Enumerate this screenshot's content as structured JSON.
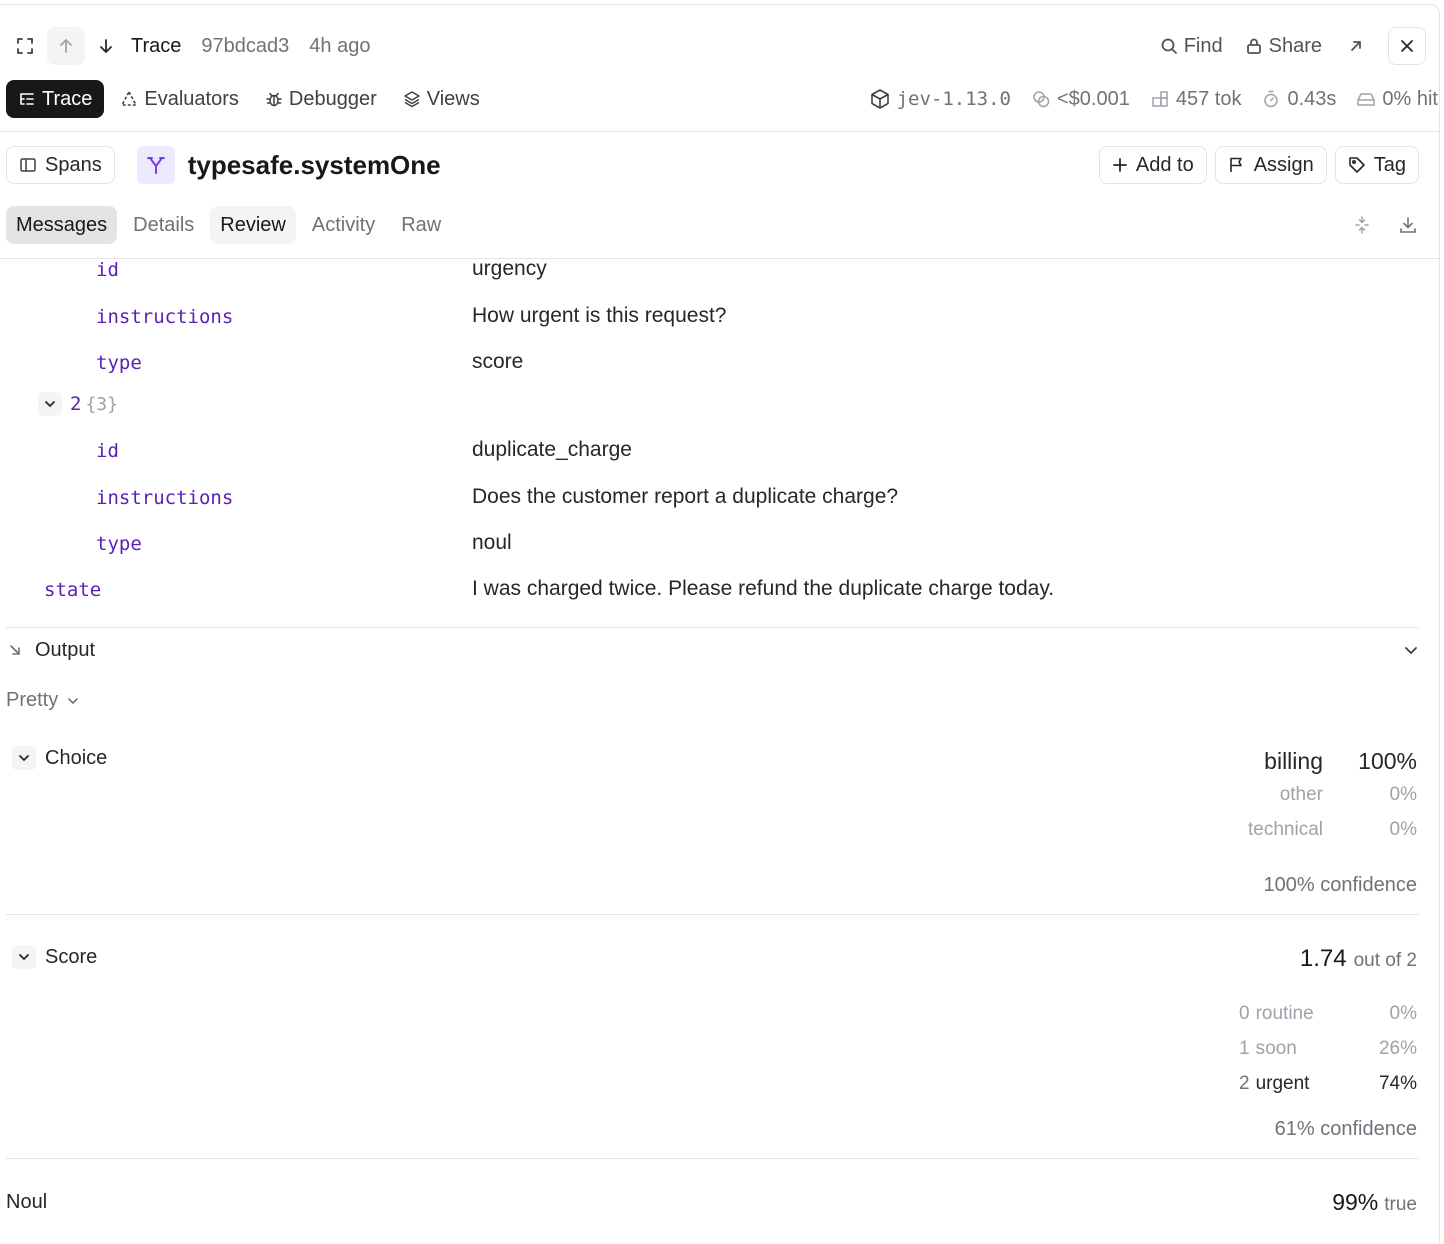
{
  "header": {
    "trace_label": "Trace",
    "trace_id": "97bdcad3",
    "time_ago": "4h ago",
    "find_label": "Find",
    "share_label": "Share"
  },
  "nav": {
    "tabs": [
      {
        "label": "Trace",
        "icon": "trace-list-icon"
      },
      {
        "label": "Evaluators",
        "icon": "triangle-dashed-icon"
      },
      {
        "label": "Debugger",
        "icon": "bug-icon"
      },
      {
        "label": "Views",
        "icon": "layers-icon"
      }
    ],
    "metrics": {
      "version": "jev-1.13.0",
      "cost": "<$0.001",
      "tokens": "457 tok",
      "latency": "0.43s",
      "cache": "0% hit"
    }
  },
  "span": {
    "spans_label": "Spans",
    "title": "typesafe.systemOne",
    "add_to_label": "Add to",
    "assign_label": "Assign",
    "tag_label": "Tag"
  },
  "subtabs": [
    "Messages",
    "Details",
    "Review",
    "Activity",
    "Raw"
  ],
  "input": {
    "item1": {
      "id_key": "id",
      "id_val": "urgency",
      "instr_key": "instructions",
      "instr_val": "How urgent is this request?",
      "type_key": "type",
      "type_val": "score"
    },
    "item2_index": "2",
    "item2_count": "{3}",
    "item2": {
      "id_key": "id",
      "id_val": "duplicate_charge",
      "instr_key": "instructions",
      "instr_val": "Does the customer report a duplicate charge?",
      "type_key": "type",
      "type_val": "noul"
    },
    "state_key": "state",
    "state_val": "I was charged twice. Please refund the duplicate charge today."
  },
  "output": {
    "title": "Output",
    "format": "Pretty",
    "choice": {
      "label": "Choice",
      "top_label": "billing",
      "top_value": "100%",
      "others": [
        {
          "label": "other",
          "value": "0%"
        },
        {
          "label": "technical",
          "value": "0%"
        }
      ],
      "confidence": "100% confidence"
    },
    "score": {
      "label": "Score",
      "value": "1.74",
      "out_of": "out of 2",
      "rows": [
        {
          "num": "0",
          "label": "routine",
          "value": "0%"
        },
        {
          "num": "1",
          "label": "soon",
          "value": "26%"
        },
        {
          "num": "2",
          "label": "urgent",
          "value": "74%"
        }
      ],
      "confidence": "61% confidence"
    },
    "noul": {
      "label": "Noul",
      "value": "99%",
      "result": "true"
    }
  }
}
